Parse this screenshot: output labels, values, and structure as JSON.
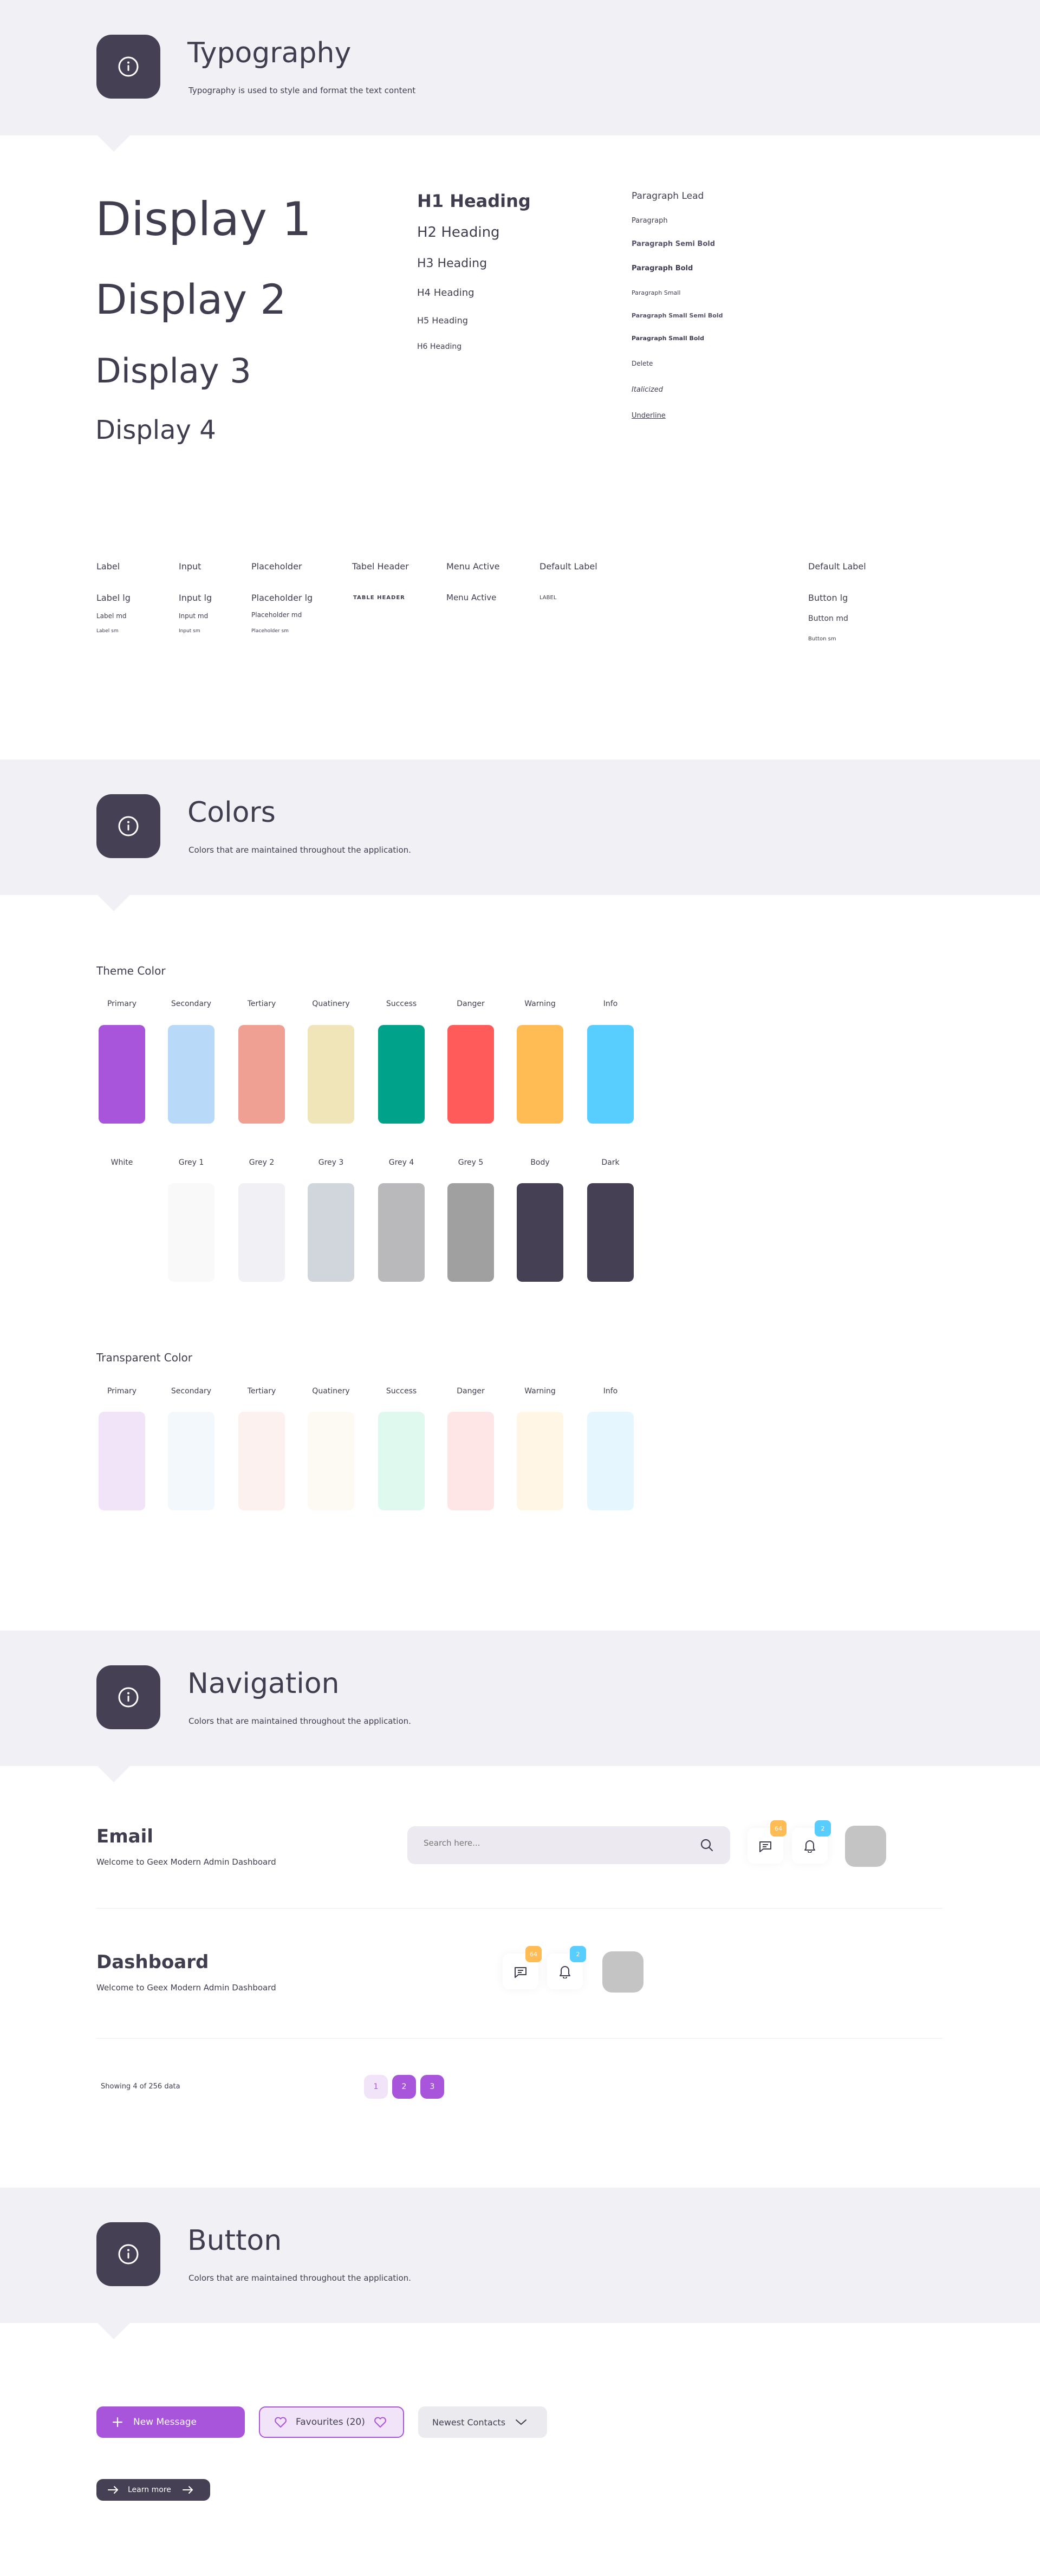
{
  "typography_section": {
    "title": "Typography",
    "subtitle": "Typography is used to style and format the text content",
    "displays": [
      "Display 1",
      "Display 2",
      "Display 3",
      "Display 4"
    ],
    "headings": [
      "H1 Heading",
      "H2 Heading",
      "H3 Heading",
      "H4 Heading",
      "H5 Heading",
      "H6 Heading"
    ],
    "paragraphs": [
      "Paragraph Lead",
      "Paragraph",
      "Paragraph Semi Bold",
      "Paragraph Bold",
      "Paragraph Small",
      "Paragraph Small Semi Bold",
      "Paragraph Small Bold",
      "Delete",
      "Italicized",
      "Underline"
    ],
    "labels": {
      "label_col": [
        "Label",
        "Label lg",
        "Label md",
        "Label sm"
      ],
      "input_col": [
        "Input",
        "Input lg",
        "Input md",
        "Input sm"
      ],
      "placeholder_col": [
        "Placeholder",
        "Placeholder lg",
        "Placeholder md",
        "Placeholder sm"
      ],
      "table_header_col": [
        "Tabel Header",
        "TABLE HEADER"
      ],
      "menu_active_col": [
        "Menu Active",
        "Menu Active"
      ],
      "default_label_col": [
        "Default Label",
        "LABEL"
      ],
      "button_col": [
        "Default Label",
        "Button lg",
        "Button md",
        "Button sm"
      ]
    }
  },
  "colors_section": {
    "title": "Colors",
    "subtitle": "Colors that are maintained throughout the application.",
    "theme_heading": "Theme Color",
    "theme_colors": [
      {
        "name": "Primary",
        "color": "#a855dc"
      },
      {
        "name": "Secondary",
        "color": "#b8d9f7"
      },
      {
        "name": "Tertiary",
        "color": "#f0a093"
      },
      {
        "name": "Quatinery",
        "color": "#f0e4b9"
      },
      {
        "name": "Success",
        "color": "#00a389"
      },
      {
        "name": "Danger",
        "color": "#ff5b5b"
      },
      {
        "name": "Warning",
        "color": "#ffbb54"
      },
      {
        "name": "Info",
        "color": "#58cdff"
      }
    ],
    "grey_colors": [
      {
        "name": "White",
        "color": "#ffffff"
      },
      {
        "name": "Grey 1",
        "color": "#f9f9f9"
      },
      {
        "name": "Grey 2",
        "color": "#f1f0f4"
      },
      {
        "name": "Grey 3",
        "color": "#d1d5dc"
      },
      {
        "name": "Grey 4",
        "color": "#b9b9bb"
      },
      {
        "name": "Grey 5",
        "color": "#a0a0a0"
      },
      {
        "name": "Body",
        "color": "#454054"
      },
      {
        "name": "Dark",
        "color": "#454054"
      }
    ],
    "transparent_heading": "Transparent Color",
    "transparent_colors": [
      {
        "name": "Primary",
        "color": "#f1e3f8"
      },
      {
        "name": "Secondary",
        "color": "#f3f8fd"
      },
      {
        "name": "Tertiary",
        "color": "#fdf1ef"
      },
      {
        "name": "Quatinery",
        "color": "#fdfaf3"
      },
      {
        "name": "Success",
        "color": "#e0f9ef"
      },
      {
        "name": "Danger",
        "color": "#ffe6e6"
      },
      {
        "name": "Warning",
        "color": "#fff6e6"
      },
      {
        "name": "Info",
        "color": "#e6f6ff"
      }
    ]
  },
  "navigation_section": {
    "title": "Navigation",
    "subtitle": "Colors that are maintained throughout the application.",
    "email_title": "Email",
    "email_subtitle": "Welcome to Geex Modern Admin Dashboard",
    "search_placeholder": "Search here...",
    "messages_badge": "64",
    "notifications_badge": "2",
    "dashboard_title": "Dashboard",
    "dashboard_subtitle": "Welcome to Geex Modern Admin Dashboard",
    "pagination_info": "Showing 4 of 256 data",
    "pages": [
      "1",
      "2",
      "3"
    ]
  },
  "button_section": {
    "title": "Button",
    "subtitle": "Colors that are maintained throughout the application.",
    "new_message": "New Message",
    "favourites": "Favourites (20)",
    "newest_contacts": "Newest Contacts",
    "learn_more": "Learn more"
  },
  "colors": {
    "primary": "#a855dc",
    "dark": "#454054",
    "band": "#f1f0f4",
    "warning": "#ffbb54",
    "info": "#58cdff"
  }
}
